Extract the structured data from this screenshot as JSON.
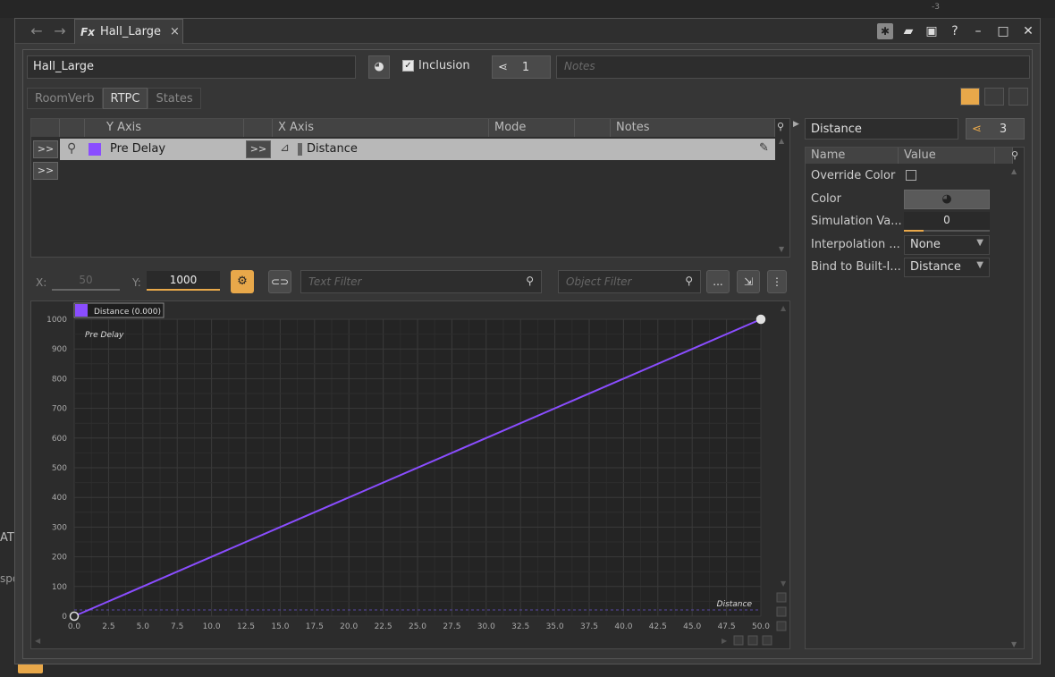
{
  "window": {
    "tab_title": "Hall_Large",
    "tab_icon": "Fx",
    "tab_close": "×"
  },
  "header": {
    "name": "Hall_Large",
    "inclusion_label": "Inclusion",
    "inclusion_checked": true,
    "share_count": "1",
    "notes_placeholder": "Notes"
  },
  "subtabs": [
    "RoomVerb",
    "RTPC",
    "States"
  ],
  "active_subtab": "RTPC",
  "rtpc_table": {
    "columns": [
      "Y Axis",
      "X Axis",
      "Mode",
      "Notes"
    ],
    "expand_label": ">>",
    "rows": [
      {
        "y_axis": "Pre Delay",
        "x_axis": "Distance",
        "mode": "",
        "notes": ""
      }
    ]
  },
  "chart_toolbar": {
    "x_label": "X:",
    "x_value": "50",
    "y_label": "Y:",
    "y_value": "1000",
    "text_filter_placeholder": "Text Filter",
    "object_filter_placeholder": "Object Filter",
    "more_label": "..."
  },
  "chart_data": {
    "type": "line",
    "legend": "Distance (0.000)",
    "series": [
      {
        "name": "Pre Delay",
        "x": [
          0,
          50
        ],
        "y": [
          0,
          1000
        ],
        "color": "#8a4dff"
      }
    ],
    "series_label": "Pre Delay",
    "x_axis_label": "Distance",
    "xlim": [
      0,
      50
    ],
    "ylim": [
      0,
      1000
    ],
    "x_ticks": [
      "0.0",
      "2.5",
      "5.0",
      "7.5",
      "10.0",
      "12.5",
      "15.0",
      "17.5",
      "20.0",
      "22.5",
      "25.0",
      "27.5",
      "30.0",
      "32.5",
      "35.0",
      "37.5",
      "40.0",
      "42.5",
      "45.0",
      "47.5",
      "50.0"
    ],
    "y_ticks": [
      "0",
      "100",
      "200",
      "300",
      "400",
      "500",
      "600",
      "700",
      "800",
      "900",
      "1000"
    ],
    "grid": true
  },
  "properties": {
    "name": "Distance",
    "share_count": "3",
    "columns": [
      "Name",
      "Value"
    ],
    "rows": [
      {
        "name": "Override Color",
        "type": "checkbox",
        "value": ""
      },
      {
        "name": "Color",
        "type": "color",
        "value": ""
      },
      {
        "name": "Simulation Va...",
        "type": "number",
        "value": "0"
      },
      {
        "name": "Interpolation ...",
        "type": "select",
        "value": "None"
      },
      {
        "name": "Bind to Built-I...",
        "type": "select",
        "value": "Distance"
      }
    ]
  },
  "colors": {
    "accent": "#e8a84a",
    "curve": "#8a4dff"
  }
}
